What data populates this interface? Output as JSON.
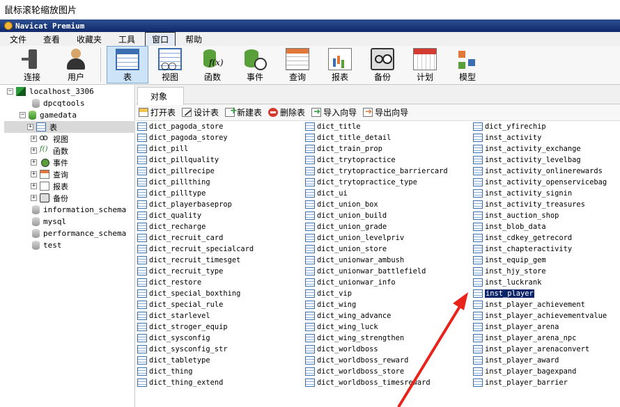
{
  "caption": "鼠标滚轮缩放图片",
  "window_title": "Navicat Premium",
  "menu": [
    "文件",
    "查看",
    "收藏夹",
    "工具",
    "窗口",
    "帮助"
  ],
  "toolbar": {
    "connect": "连接",
    "user": "用户",
    "table": "表",
    "view": "视图",
    "function": "函数",
    "event": "事件",
    "query": "查询",
    "report": "报表",
    "backup": "备份",
    "schedule": "计划",
    "model": "模型"
  },
  "tree": {
    "connection": "localhost_3306",
    "db_dpcqtools": "dpcqtools",
    "db_gamedata": "gamedata",
    "node_tables": "表",
    "node_views": "视图",
    "node_functions": "函数",
    "node_events": "事件",
    "node_queries": "查询",
    "node_reports": "报表",
    "node_backups": "备份",
    "db_information_schema": "information_schema",
    "db_mysql": "mysql",
    "db_performance_schema": "performance_schema",
    "db_test": "test"
  },
  "tab_objects": "对象",
  "object_toolbar": {
    "open": "打开表",
    "design": "设计表",
    "new": "新建表",
    "delete": "删除表",
    "import": "导入向导",
    "export": "导出向导"
  },
  "columns": [
    [
      "dict_pagoda_store",
      "dict_pagoda_storey",
      "dict_pill",
      "dict_pillquality",
      "dict_pillrecipe",
      "dict_pillthing",
      "dict_pilltype",
      "dict_playerbaseprop",
      "dict_quality",
      "dict_recharge",
      "dict_recruit_card",
      "dict_recruit_specialcard",
      "dict_recruit_timesget",
      "dict_recruit_type",
      "dict_restore",
      "dict_special_boxthing",
      "dict_special_rule",
      "dict_starlevel",
      "dict_stroger_equip",
      "dict_sysconfig",
      "dict_sysconfig_str",
      "dict_tabletype",
      "dict_thing",
      "dict_thing_extend"
    ],
    [
      "dict_title",
      "dict_title_detail",
      "dict_train_prop",
      "dict_trytopractice",
      "dict_trytopractice_barriercard",
      "dict_trytopractice_type",
      "dict_ui",
      "dict_union_box",
      "dict_union_build",
      "dict_union_grade",
      "dict_union_levelpriv",
      "dict_union_store",
      "dict_unionwar_ambush",
      "dict_unionwar_battlefield",
      "dict_unionwar_info",
      "dict_vip",
      "dict_wing",
      "dict_wing_advance",
      "dict_wing_luck",
      "dict_wing_strengthen",
      "dict_worldboss",
      "dict_worldboss_reward",
      "dict_worldboss_store",
      "dict_worldboss_timesreward"
    ],
    [
      "dict_yfirechip",
      "inst_activity",
      "inst_activity_exchange",
      "inst_activity_levelbag",
      "inst_activity_onlinerewards",
      "inst_activity_openservicebag",
      "inst_activity_signin",
      "inst_activity_treasures",
      "inst_auction_shop",
      "inst_blob_data",
      "inst_cdkey_getrecord",
      "inst_chapteractivity",
      "inst_equip_gem",
      "inst_hjy_store",
      "inst_luckrank",
      "inst_player",
      "inst_player_achievement",
      "inst_player_achievementvalue",
      "inst_player_arena",
      "inst_player_arena_npc",
      "inst_player_arenaconvert",
      "inst_player_award",
      "inst_player_bagexpand",
      "inst_player_barrier"
    ]
  ],
  "selected_table": "inst_player",
  "colors": {
    "titlebar": "#10296b",
    "selection": "#0a246a",
    "annotation_arrow": "#e8231c"
  }
}
